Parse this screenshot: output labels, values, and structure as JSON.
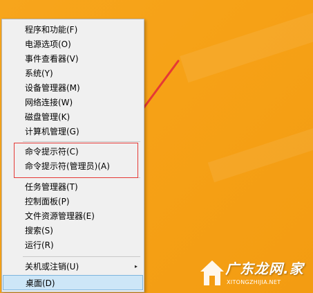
{
  "context_menu": {
    "items": [
      {
        "label": "程序和功能(F)"
      },
      {
        "label": "电源选项(O)"
      },
      {
        "label": "事件查看器(V)"
      },
      {
        "label": "系统(Y)"
      },
      {
        "label": "设备管理器(M)"
      },
      {
        "label": "网络连接(W)"
      },
      {
        "label": "磁盘管理(K)"
      },
      {
        "label": "计算机管理(G)"
      },
      {
        "label": "命令提示符(C)"
      },
      {
        "label": "命令提示符(管理员)(A)"
      },
      {
        "label": "任务管理器(T)"
      },
      {
        "label": "控制面板(P)"
      },
      {
        "label": "文件资源管理器(E)"
      },
      {
        "label": "搜索(S)"
      },
      {
        "label": "运行(R)"
      },
      {
        "label": "关机或注销(U)"
      },
      {
        "label": "桌面(D)"
      }
    ],
    "submenu_arrow": "▸",
    "selected_item": "桌面(D)"
  },
  "annotation": {
    "highlight_color": "#e53935",
    "arrow_color": "#e53935"
  },
  "watermark": {
    "title": "广东龙网.家",
    "url": "XITONGZHIJIA.NET"
  },
  "colors": {
    "wallpaper": "#f6a116",
    "menu_bg": "#f0f0f0",
    "selection": "#cde6f7"
  }
}
